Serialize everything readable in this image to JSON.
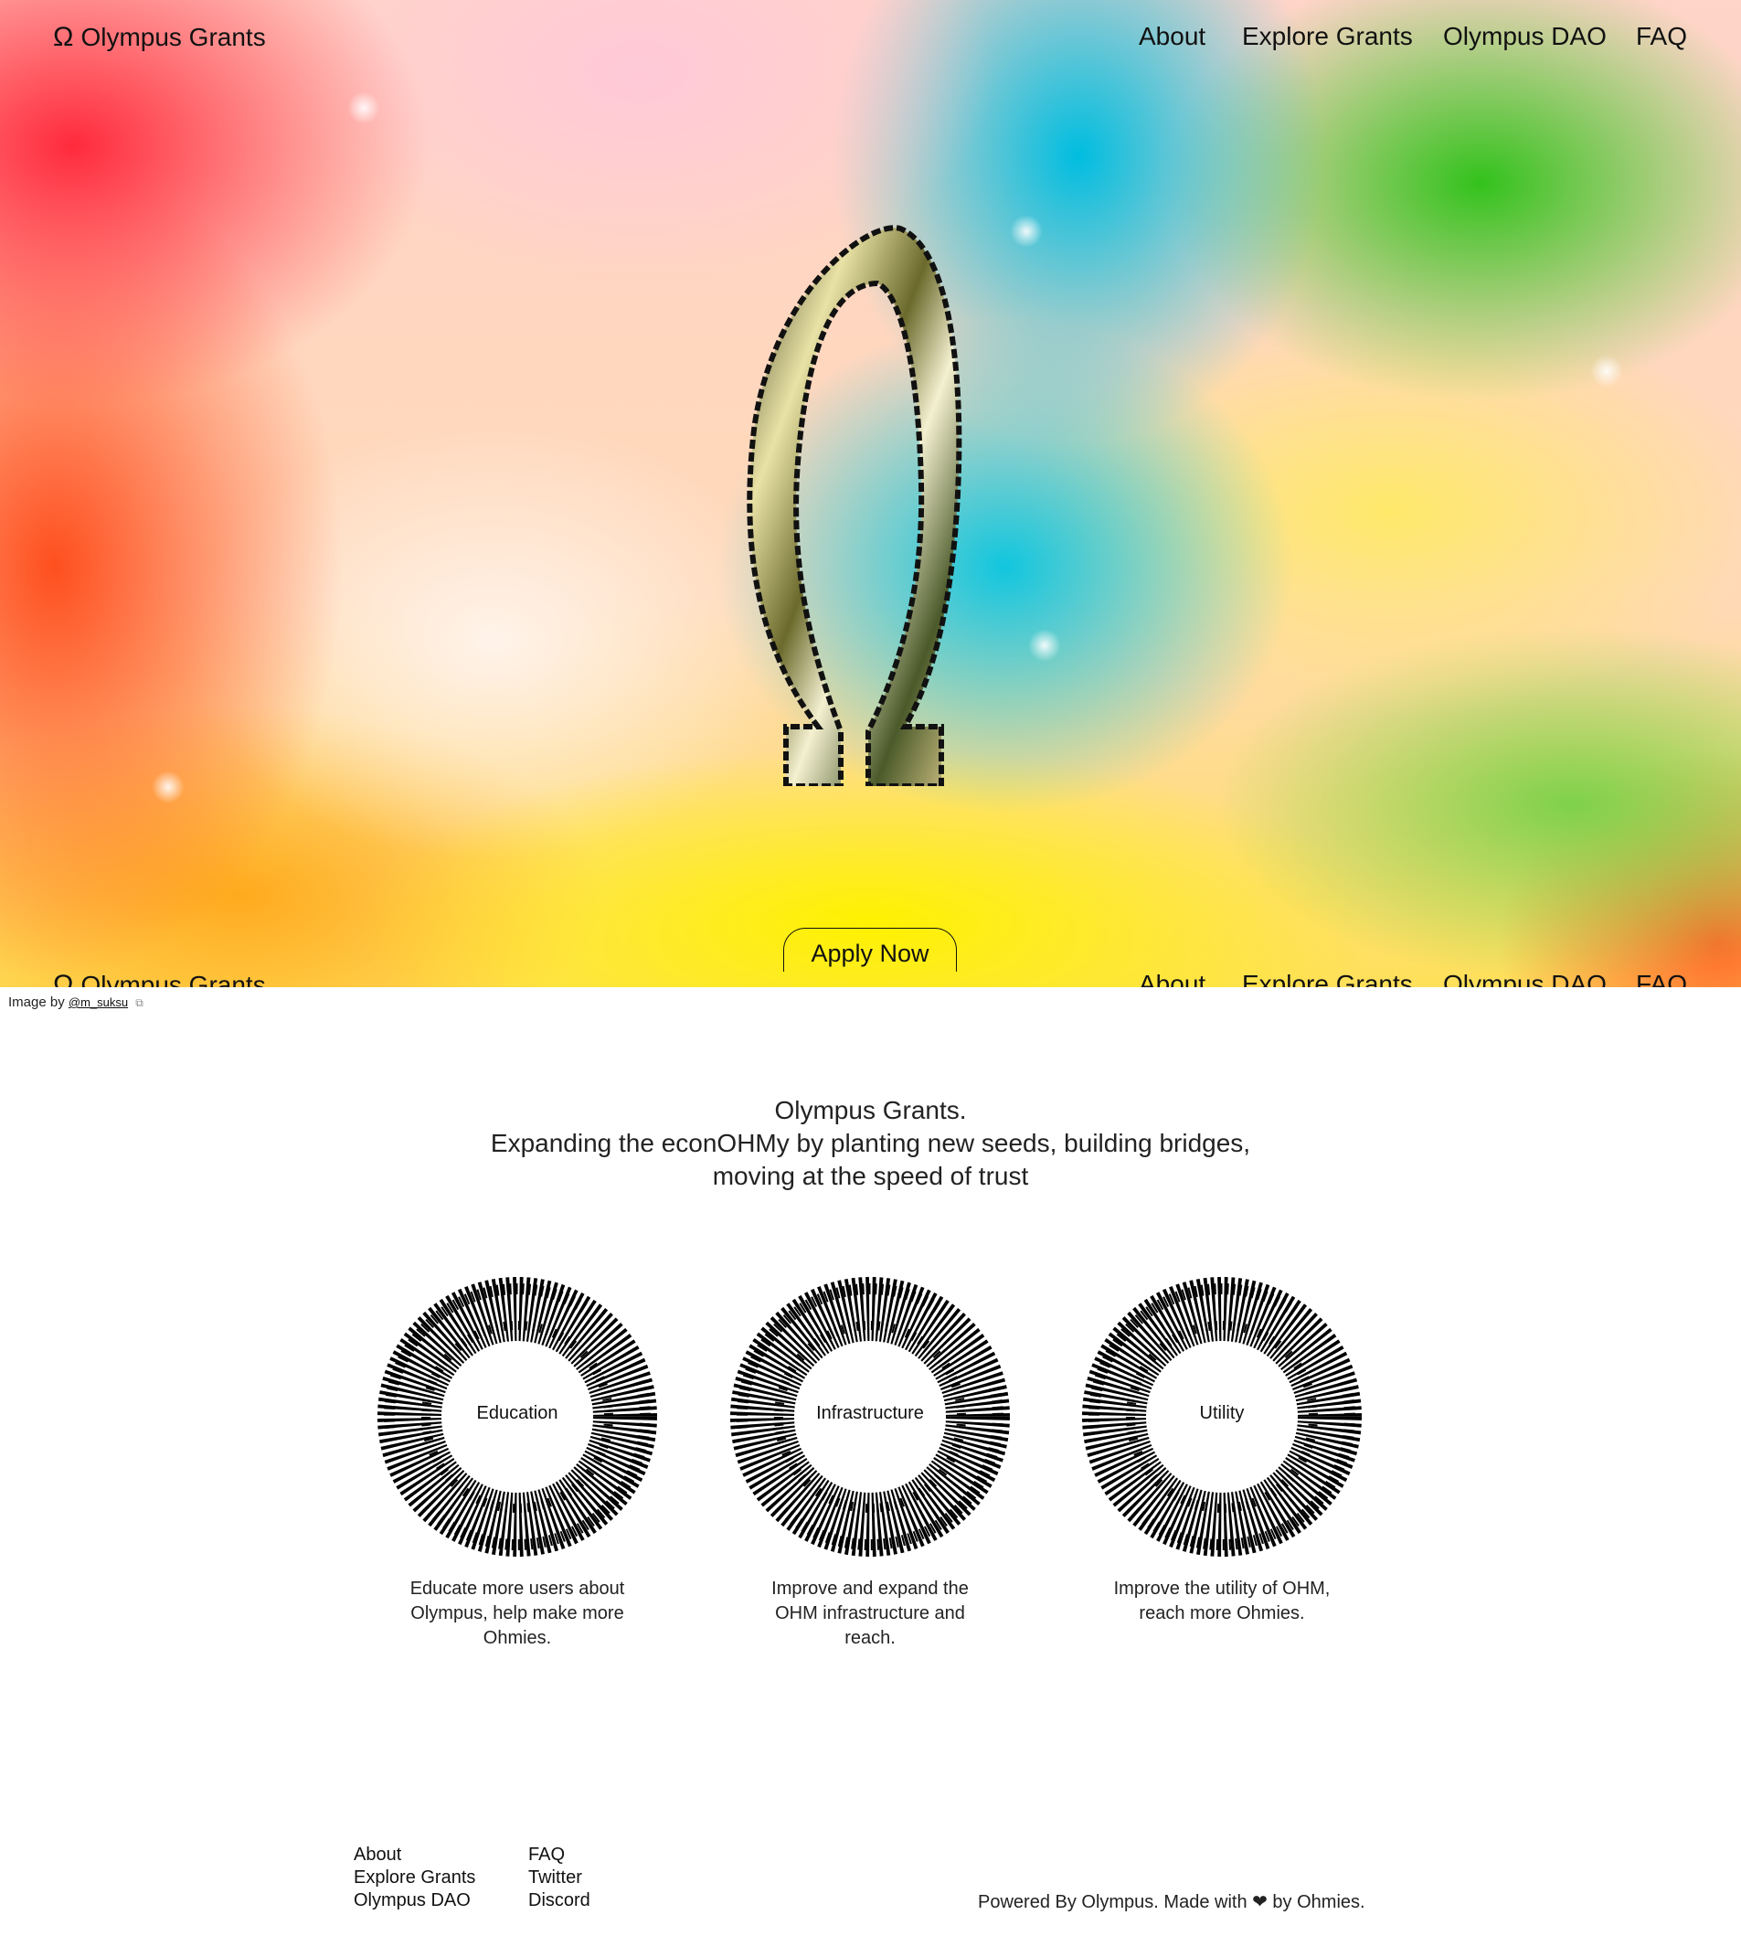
{
  "header": {
    "brand": "Olympus Grants",
    "brand_icon": "omega-icon",
    "nav": [
      "About",
      "Explore Grants",
      "Olympus DAO",
      "FAQ"
    ]
  },
  "hero": {
    "apply_label": "Apply Now",
    "credit_prefix": "Image by",
    "credit_handle": "@m_suksu",
    "credit_icon": "external-link-icon"
  },
  "intro": {
    "line1": "Olympus Grants.",
    "line2": "Expanding the econOHMy by planting new seeds, building bridges,",
    "line3": "moving at the speed of trust"
  },
  "categories": [
    {
      "label": "Education",
      "description": "Educate more users about Olympus, help make more Ohmies."
    },
    {
      "label": "Infrastructure",
      "description": "Improve and expand the OHM infrastructure and reach."
    },
    {
      "label": "Utility",
      "description": "Improve the utility of OHM, reach more Ohmies."
    }
  ],
  "footer": {
    "col1": [
      "About",
      "Explore Grants",
      "Olympus DAO"
    ],
    "col2": [
      "FAQ",
      "Twitter",
      "Discord"
    ],
    "powered": "Powered By Olympus. Made with ❤ by Ohmies."
  }
}
